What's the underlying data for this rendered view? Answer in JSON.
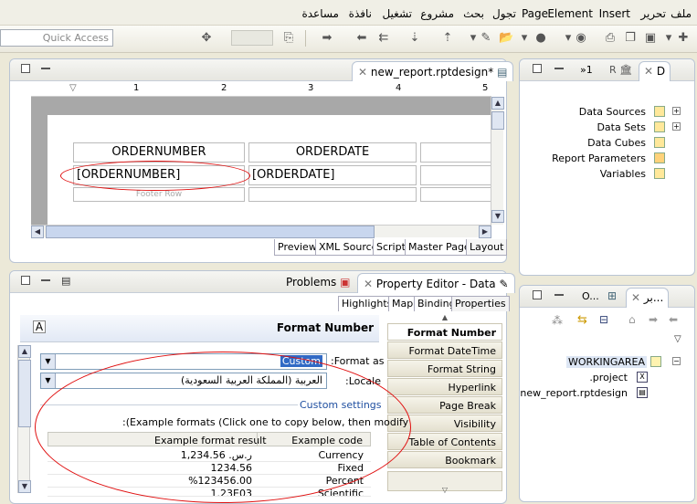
{
  "menu": [
    "ملف",
    "تحرير",
    "Insert",
    "Element",
    "Page",
    "تجول",
    "بحث",
    "مشروع",
    "تشغيل",
    "نافذة",
    "مساعدة"
  ],
  "toolbar": {
    "quick_access_placeholder": "Quick Access"
  },
  "editor": {
    "tab_title": "new_report.rptdesign*",
    "ruler_marks": [
      "1",
      "2",
      "3",
      "4",
      "5"
    ],
    "table": {
      "headers": [
        "ORDERNUMBER",
        "ORDERDATE"
      ],
      "cells": [
        "[ORDERNUMBER]",
        "[ORDERDATE]"
      ],
      "footer_label": "Footer Row"
    },
    "bottom_tabs": [
      "Preview",
      "XML Source",
      "Script",
      "Master Page",
      "Layout"
    ]
  },
  "outline": {
    "tabs": [
      "1",
      "R",
      "D"
    ],
    "items": [
      "Data Sources",
      "Data Sets",
      "Data Cubes",
      "Report Parameters",
      "Variables"
    ]
  },
  "property_panel": {
    "tab_problems": "Problems",
    "tab_property": "Property Editor - Data",
    "sub_tabs": [
      "Highlights",
      "Map",
      "Binding",
      "Properties"
    ],
    "header_title": "Format Number",
    "categories": [
      "Format Number",
      "Format DateTime",
      "Format String",
      "Hyperlink",
      "Page Break",
      "Visibility",
      "Table of Contents",
      "Bookmark"
    ],
    "format_as_label": ":Format as",
    "format_as_value": "Custom",
    "locale_label": ":Locale",
    "locale_value": "العربية (المملكة العربية السعودية)",
    "custom_settings": "Custom settings",
    "example_hint": ":(Example formats (Click one to copy below, then modify",
    "example_columns": [
      "Example format result",
      "Example code"
    ],
    "examples": [
      {
        "result": "ر.س.‏ 1,234.56",
        "code": "Currency"
      },
      {
        "result": "1234.56",
        "code": "Fixed"
      },
      {
        "result": "%123456.00",
        "code": "Percent"
      },
      {
        "result": "1.23E03",
        "code": "Scientific"
      }
    ]
  },
  "navigator": {
    "tab_left": "O...",
    "tab_right": "بر...",
    "root": "WORKINGAREA",
    "children": [
      ".project",
      "new_report.rptdesign"
    ]
  },
  "colors": {
    "accent": "#316ac5",
    "link_blue": "#1f4fa0",
    "annotation_red": "#e01010"
  }
}
